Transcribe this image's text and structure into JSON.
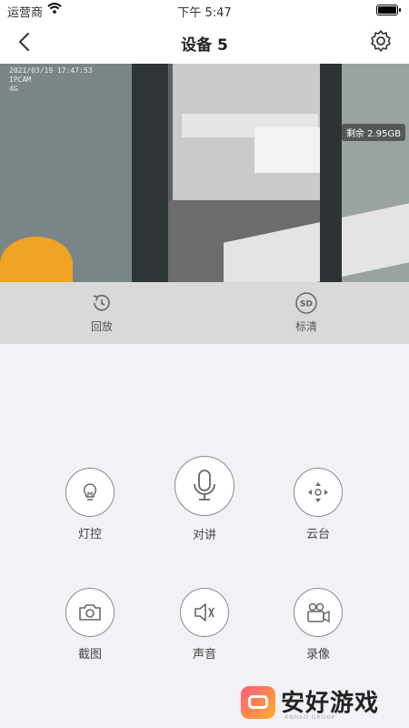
{
  "status_bar": {
    "carrier": "运营商",
    "time": "下午 5:47"
  },
  "nav": {
    "title": "设备 5"
  },
  "video": {
    "osd_lines": [
      "2021/03/19 17:47:53",
      "IPCAM",
      "4G"
    ],
    "remaining": "剩余 2.95GB"
  },
  "playbar": {
    "playback_label": "回放",
    "quality_label": "标清",
    "quality_icon_text": "SD"
  },
  "controls": {
    "light": "灯控",
    "talk": "对讲",
    "ptz": "云台",
    "snapshot": "截图",
    "sound": "声音",
    "record": "录像"
  },
  "watermark": {
    "text": "安好游戏",
    "sub": "ANHAO GROUP"
  },
  "colors": {
    "accent": "#8a8a8a",
    "background": "#f2f2f6",
    "playbar": "#d9d9d9"
  }
}
